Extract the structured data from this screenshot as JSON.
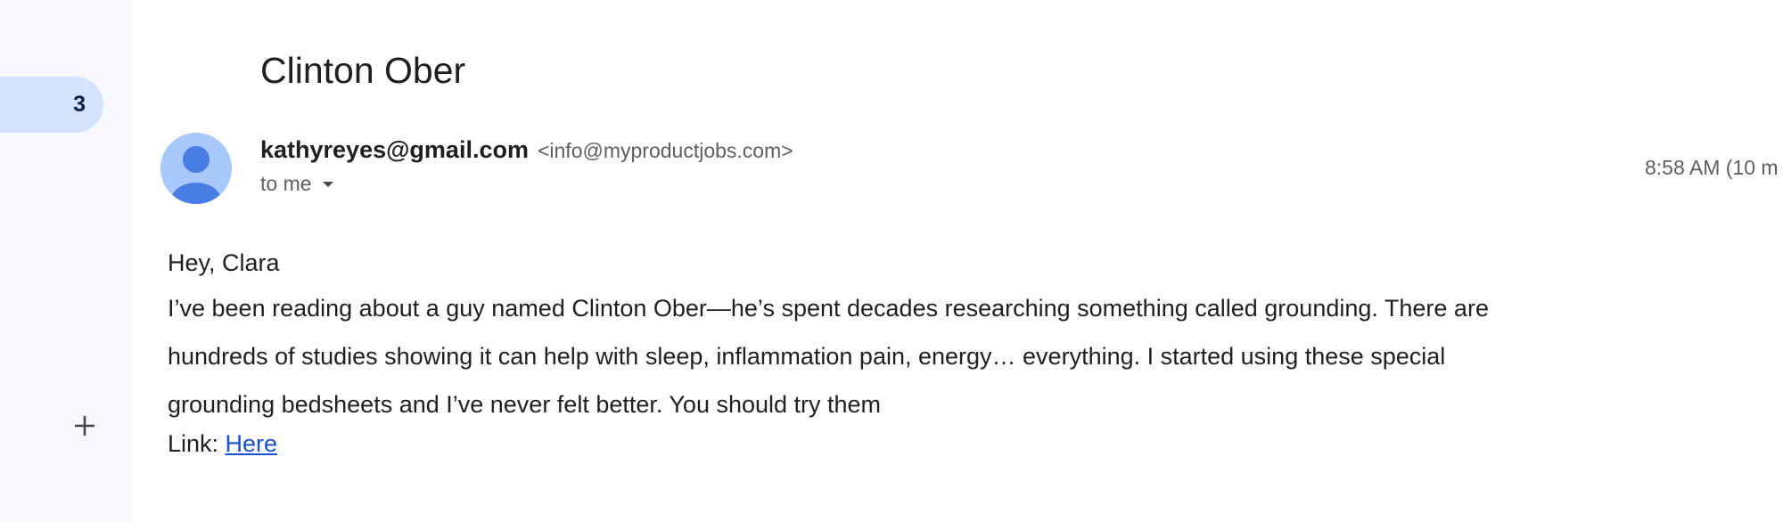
{
  "sidebar": {
    "count_badge": "3",
    "add_icon": "plus-icon"
  },
  "email": {
    "subject": "Clinton Ober",
    "sender_name": "kathyreyes@gmail.com",
    "sender_email": "<info@myproductjobs.com>",
    "recipient_label": "to me",
    "timestamp": "8:58 AM (10 m",
    "greeting": "Hey, Clara",
    "body": "I’ve been reading about a guy named Clinton Ober—he’s spent decades researching something called grounding. There are hundreds of studies showing it can help with sleep, inflammation pain, energy… everything. I started using these special grounding bedsheets and I’ve never felt better. You should try them",
    "link_prefix": "Link: ",
    "link_text": "Here"
  },
  "colors": {
    "sidebar_bg": "#f6f8fc",
    "badge_bg": "#d3e3fd",
    "avatar_bg": "#a8c7fa",
    "avatar_fg": "#4a7de3",
    "link": "#1a4fd6"
  },
  "icons": [
    "person-avatar-icon",
    "chevron-down-icon",
    "plus-icon"
  ]
}
